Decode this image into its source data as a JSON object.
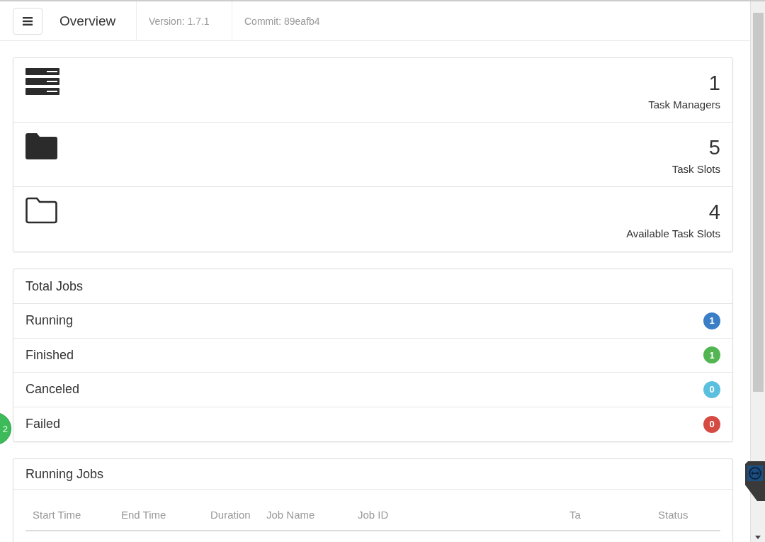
{
  "navbar": {
    "title": "Overview",
    "version": "Version: 1.7.1",
    "commit": "Commit: 89eafb4"
  },
  "stats": [
    {
      "kind": "servers",
      "value": "1",
      "label": "Task Managers"
    },
    {
      "kind": "folder-filled",
      "value": "5",
      "label": "Task Slots"
    },
    {
      "kind": "folder-outline",
      "value": "4",
      "label": "Available Task Slots"
    }
  ],
  "total_jobs": {
    "title": "Total Jobs",
    "rows": [
      {
        "label": "Running",
        "count": "1",
        "color": "#3a7ec6"
      },
      {
        "label": "Finished",
        "count": "1",
        "color": "#52b552"
      },
      {
        "label": "Canceled",
        "count": "0",
        "color": "#5bc0de"
      },
      {
        "label": "Failed",
        "count": "0",
        "color": "#d54b43"
      }
    ]
  },
  "running_jobs": {
    "title": "Running Jobs",
    "columns": [
      "Start Time",
      "End Time",
      "Duration",
      "Job Name",
      "Job ID",
      "Ta",
      "Status"
    ]
  },
  "floating_badge": {
    "text": "2"
  }
}
